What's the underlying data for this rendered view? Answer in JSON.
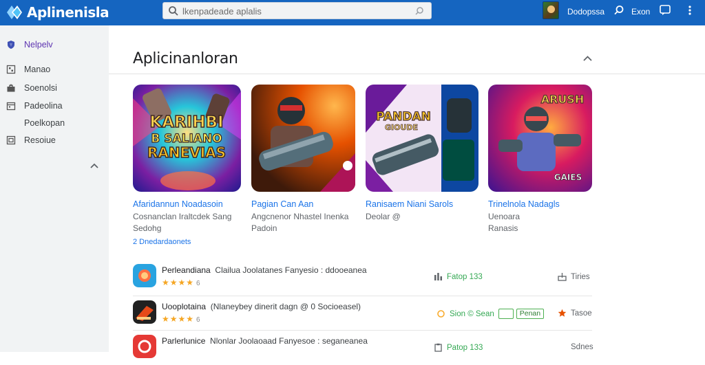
{
  "header": {
    "logo_text": "Aplinenisla",
    "search_placeholder": "lkenpadeade aplalis",
    "account_name": "Dodopssa",
    "link": "Exon"
  },
  "sidebar": {
    "items": [
      {
        "label": "Nelpelv",
        "icon": "shield-icon"
      },
      {
        "label": "Manao",
        "icon": "grid-icon"
      },
      {
        "label": "Soenolsi",
        "icon": "briefcase-icon"
      },
      {
        "label": "Padeolina",
        "icon": "calendar-icon"
      },
      {
        "label": "Poelkopan",
        "icon": ""
      },
      {
        "label": "Resoiue",
        "icon": "list-icon"
      }
    ]
  },
  "main": {
    "section_title": "Aplicinanloran",
    "featured": [
      {
        "title": "Afaridannun Noadasoin",
        "sub1": "Cosnanclan Iraltcdek Sang",
        "sub2": "Sedohg",
        "art_text1": "KARIHBI",
        "art_text2": "B SALIANO",
        "art_text3": "RANEVIAS"
      },
      {
        "title": "Pagian Can Aan",
        "sub1": "Angcnenor Nhastel Inenka",
        "sub2": "Padoin",
        "art_text1": "",
        "art_text2": "",
        "art_text3": ""
      },
      {
        "title": "Ranisaem Niani Sarols",
        "sub1": "Deolar @",
        "sub2": "",
        "art_text1": "PANDAN",
        "art_text2": "GIOUDE",
        "art_text3": ""
      },
      {
        "title": "Trinelnola Nadagls",
        "sub1": "Uenoara",
        "sub2": "Ranasis",
        "art_text1": "ARUSH",
        "art_text2": "GAIES",
        "art_text3": ""
      }
    ],
    "more_link": "2  Dnedardaonets",
    "rows": [
      {
        "name": "Perleandiana",
        "desc": "Clailua Joolatanes Fanyesio : ddooeanea",
        "rating_num": "6",
        "stat": "Fatop 133",
        "right": "Tiries",
        "icon_color": "#29a3e0"
      },
      {
        "name": "Uooplotaina",
        "desc": "(Nlaneybey dinerit dagn @ 0 Socioeasel)",
        "rating_num": "6",
        "stat": "Sion © Sean",
        "chip": "Penan",
        "right": "Tasoe",
        "icon_color": "#d84315"
      },
      {
        "name": "Parlerlunice",
        "desc": "Nlonlar Joolaoaad Fanyesoe : seganeanea",
        "rating_num": "",
        "stat": "Patop 133",
        "right": "Sdnes",
        "icon_color": "#e53935"
      }
    ]
  },
  "colors": {
    "brand": "#1565c0",
    "link": "#1a73e8",
    "accent_purple": "#5e35b1",
    "green": "#34a853",
    "star": "#f5a623"
  }
}
